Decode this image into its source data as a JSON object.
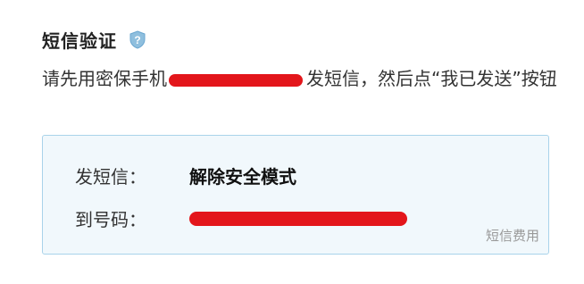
{
  "title": "短信验证",
  "icons": {
    "help": "shield-question-icon"
  },
  "instruction": {
    "before": "请先用密保手机",
    "after": "发短信，然后点“我已发送”按钮"
  },
  "sms_box": {
    "send_label": "发短信：",
    "send_value": "解除安全模式",
    "to_label": "到号码：",
    "fee_link": "短信费用"
  },
  "colors": {
    "redaction": "#e3161b",
    "box_background": "#f1f8fc",
    "box_border": "#a9d3ea",
    "fee_text": "#999999"
  }
}
